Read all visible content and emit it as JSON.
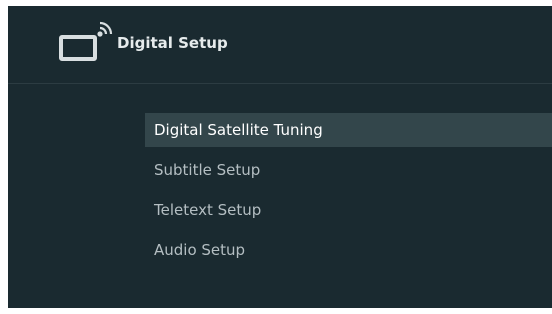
{
  "header": {
    "title": "Digital Setup",
    "icon": "tv-antenna-icon"
  },
  "menu": {
    "items": [
      {
        "label": "Digital Satellite Tuning",
        "selected": true
      },
      {
        "label": "Subtitle Setup",
        "selected": false
      },
      {
        "label": "Teletext Setup",
        "selected": false
      },
      {
        "label": "Audio Setup",
        "selected": false
      }
    ]
  },
  "colors": {
    "background": "#1a2a30",
    "highlight": "#33464b",
    "text_selected": "#ffffff",
    "text_normal": "#b4bec2"
  }
}
